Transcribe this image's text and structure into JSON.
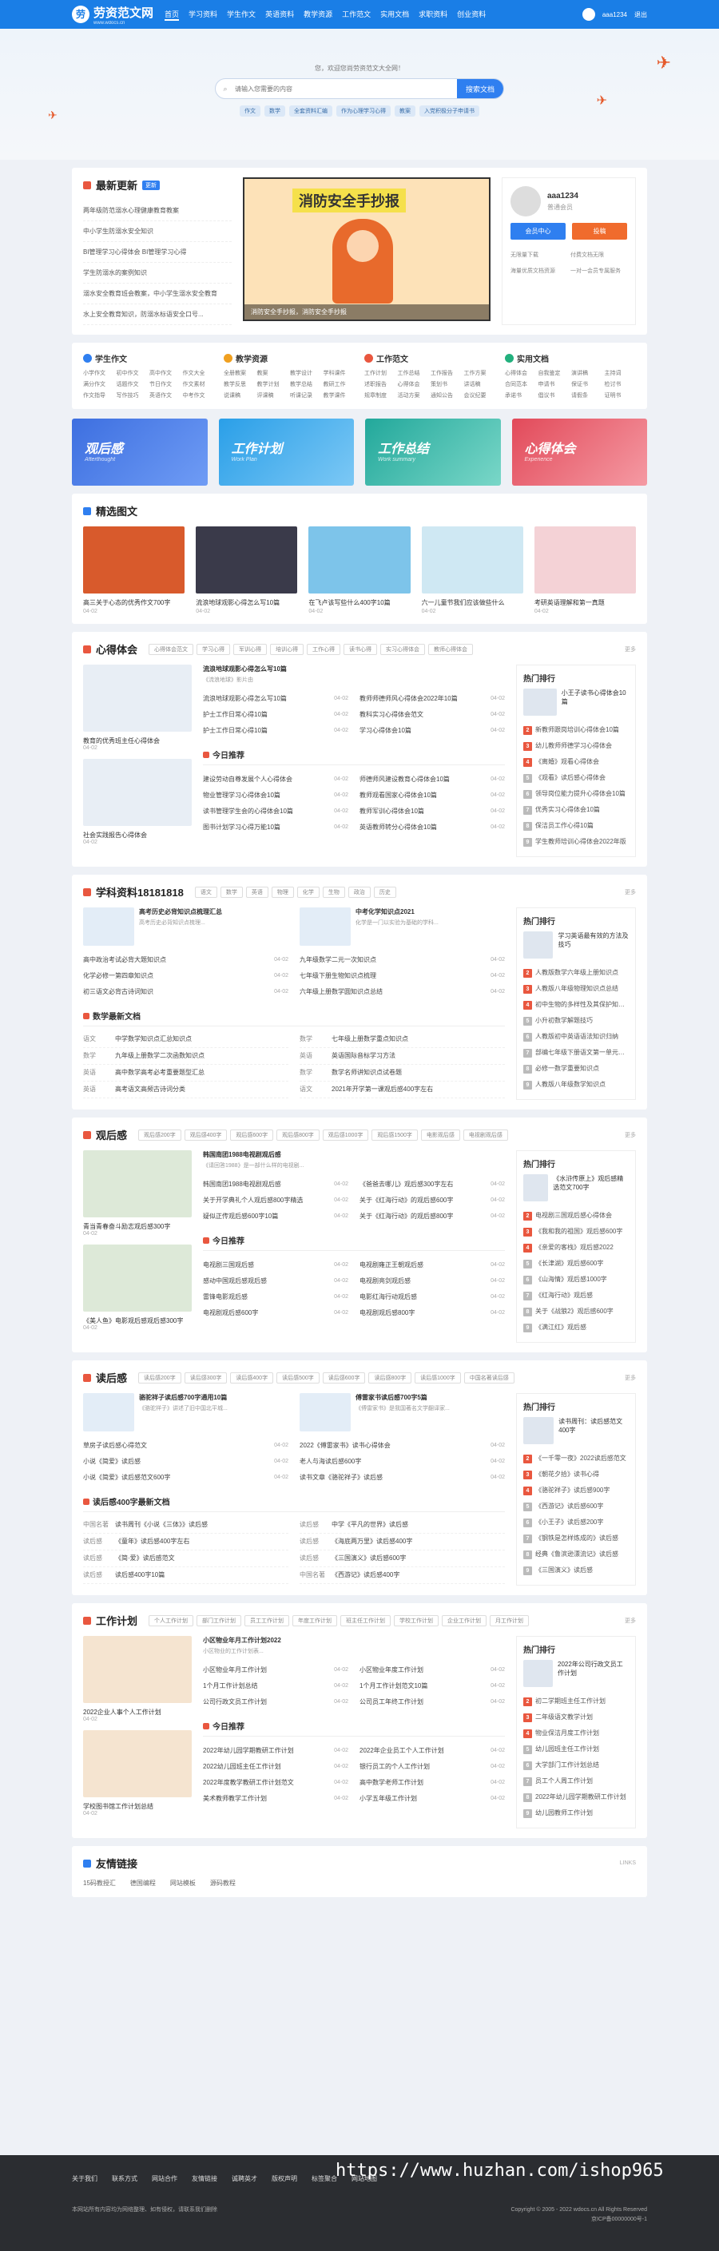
{
  "header": {
    "logo": "劳资范文网",
    "logo_sub": "www.wdocs.cn",
    "nav": [
      "首页",
      "学习资料",
      "学生作文",
      "英语资料",
      "教学资源",
      "工作范文",
      "实用文档",
      "求职资料",
      "创业资料"
    ],
    "user": "aaa1234",
    "logout": "退出"
  },
  "hero": {
    "welcome": "您，欢迎您尚劳资范文大全网！",
    "placeholder": "请输入您需要的内容",
    "search_btn": "搜索文档",
    "keywords": [
      "作文",
      "数学",
      "全套资料汇编",
      "作为心理学习心得",
      "教案",
      "入党积极分子申请书"
    ]
  },
  "news": {
    "title": "最新更新",
    "badge": "更新",
    "items": [
      "两年级防范溺水心理健康教育教案",
      "中小学生防溺水安全知识",
      "BI管理学习心得体会 BI管理学习心得",
      "学生防溺水的案例知识",
      "溺水安全教育班会教案，中小学生溺水安全教育",
      "水上安全教育知识，防溺水标语安全口号..."
    ]
  },
  "banner": {
    "title": "消防安全手抄报",
    "caption": "消防安全手抄报，消防安全手抄报"
  },
  "user_card": {
    "name": "aaa1234",
    "desc": "普通会员",
    "btn1": "会员中心",
    "btn2": "投稿",
    "perks": [
      "无限量下载",
      "付费文档无限",
      "海量优质文档资源",
      "一对一会员专属服务"
    ]
  },
  "cats": [
    {
      "name": "学生作文",
      "items": [
        "小学作文",
        "初中作文",
        "高中作文",
        "作文大全",
        "满分作文",
        "话题作文",
        "节日作文",
        "作文素材",
        "作文指导",
        "写作技巧",
        "英语作文",
        "中考作文"
      ]
    },
    {
      "name": "教学资源",
      "items": [
        "全册教案",
        "教案",
        "教学设计",
        "学科课件",
        "教学反思",
        "教学计划",
        "教学总结",
        "教研工作",
        "说课稿",
        "评课稿",
        "听课记录",
        "教学课件"
      ]
    },
    {
      "name": "工作范文",
      "items": [
        "工作计划",
        "工作总结",
        "工作报告",
        "工作方案",
        "述职报告",
        "心得体会",
        "策划书",
        "讲话稿",
        "规章制度",
        "活动方案",
        "通知公告",
        "会议纪要"
      ]
    },
    {
      "name": "实用文档",
      "items": [
        "心得体会",
        "自我鉴定",
        "演讲稿",
        "主持词",
        "合同范本",
        "申请书",
        "保证书",
        "检讨书",
        "承诺书",
        "倡议书",
        "请假条",
        "证明书"
      ]
    }
  ],
  "promo": [
    {
      "t": "观后感",
      "s": "Afterthought"
    },
    {
      "t": "工作计划",
      "s": "Work Plan"
    },
    {
      "t": "工作总结",
      "s": "Work summary"
    },
    {
      "t": "心得体会",
      "s": "Experience"
    }
  ],
  "pics": {
    "title": "精选图文",
    "items": [
      {
        "t": "高三关于心态的优秀作文700字",
        "d": "04-02"
      },
      {
        "t": "流浪地球观影心得怎么写10篇",
        "d": "04-02"
      },
      {
        "t": "在飞卢该写些什么400字10篇",
        "d": "04-02"
      },
      {
        "t": "六一儿童节我们应该做些什么",
        "d": "04-02"
      },
      {
        "t": "考研英语理解和第一真题",
        "d": "04-02"
      }
    ]
  },
  "s1": {
    "title": "心得体会",
    "tags": [
      "心得体会范文",
      "学习心得",
      "军训心得",
      "培训心得",
      "工作心得",
      "读书心得",
      "实习心得体会",
      "教师心得体会"
    ],
    "more": "更多",
    "left": [
      {
        "c": "教育的优秀班主任心得体会",
        "d": "04-02"
      },
      {
        "c": "社会实践报告心得体会",
        "d": "04-02"
      }
    ],
    "feat": {
      "t": "流浪地球观影心得怎么写10篇",
      "p": "《流浪地球》影片由"
    },
    "list": [
      [
        "流浪地球观影心得怎么写10篇",
        "04-02"
      ],
      [
        "教师师德师风心得体会2022年10篇",
        "04-02"
      ],
      [
        "护士工作日常心得10篇",
        "04-02"
      ],
      [
        "教科实习心得体会范文",
        "04-02"
      ],
      [
        "护士工作日常心得10篇",
        "04-02"
      ],
      [
        "学习心得体会10篇",
        "04-02"
      ]
    ],
    "sub": "今日推荐",
    "sublist": [
      [
        "建设劳动自尊发展个人心得体会",
        "04-02"
      ],
      [
        "师德师风建设教育心得体会10篇",
        "04-02"
      ],
      [
        "物业管理学习心得体会10篇",
        "04-02"
      ],
      [
        "教师观看国家心得体会10篇",
        "04-02"
      ],
      [
        "读书管理学生会的心得体会10篇",
        "04-02"
      ],
      [
        "教师军训心得体会10篇",
        "04-02"
      ],
      [
        "图书计划学习心得万能10篇",
        "04-02"
      ],
      [
        "英语教师转分心得体会10篇",
        "04-02"
      ]
    ],
    "hot": {
      "title": "热门排行",
      "top": "小王子读书心得体会10篇",
      "items": [
        "新教师跟岗培训心得体会10篇",
        "幼儿教师师德学习心得体会",
        "《离婚》观看心得体会",
        "《观看》读后感心得体会",
        "领导岗位能力提升心得体会10篇",
        "优秀实习心得体会10篇",
        "保洁员工作心得10篇",
        "学生教师培训心得体会2022年版"
      ]
    }
  },
  "s2": {
    "title": "学科资料18181818",
    "tags": [
      "语文",
      "数学",
      "英语",
      "物理",
      "化学",
      "生物",
      "政治",
      "历史"
    ],
    "more": "更多",
    "feat1": {
      "t": "高考历史必背知识点梳理汇总",
      "p": "高考历史必背知识点梳理..."
    },
    "feat2": {
      "t": "中考化学知识点2021",
      "p": "化学是一门以实验为基础的学科..."
    },
    "list": [
      [
        "高中政治考试必背大题知识点",
        "04-02"
      ],
      [
        "九年级数学二元一次知识点",
        "04-02"
      ],
      [
        "化学必修一第四章知识点",
        "04-02"
      ],
      [
        "七年级下册生物知识点梳理",
        "04-02"
      ],
      [
        "初三语文必背古诗词知识",
        "04-02"
      ],
      [
        "六年级上册数学圆知识点总结",
        "04-02"
      ]
    ],
    "sub": "数学最新文档",
    "docs": [
      [
        "语文",
        "中学数学知识点汇总知识点"
      ],
      [
        "数学",
        "七年级上册数学重点知识点"
      ],
      [
        "数学",
        "九年级上册数学二次函数知识点"
      ],
      [
        "英语",
        "英语国际音标学习方法"
      ],
      [
        "英语",
        "高中数学高考必考重要题型汇总"
      ],
      [
        "数学",
        "数学名师讲知识点试卷题"
      ],
      [
        "英语",
        "高考语文高频古诗词分类"
      ],
      [
        "语文",
        "2021年开学第一课观后感400字左右"
      ]
    ],
    "hot": {
      "title": "热门排行",
      "top": "学习英语最有效的方法及技巧",
      "items": [
        "人教版数学六年级上册知识点",
        "人教版八年级物理知识点总结",
        "初中生物的多样性及其保护知识点",
        "小升初数学解题技巧",
        "人教版初中英语语法知识归纳",
        "部编七年级下册语文第一单元知识点",
        "必修一数学重要知识点",
        "人教版八年级数学知识点"
      ]
    }
  },
  "s3": {
    "title": "观后感",
    "tags": [
      "观后感200字",
      "观后感400字",
      "观后感600字",
      "观后感800字",
      "观后感1000字",
      "观后感1500字",
      "电影观后感",
      "电视剧观后感"
    ],
    "more": "更多",
    "left": [
      {
        "c": "青当青春奋斗励志观后感300字",
        "d": "04-02"
      },
      {
        "c": "《美人鱼》电影观后感观后感300字",
        "d": "04-02"
      }
    ],
    "feat": {
      "t": "韩国南团1988电视剧观后感",
      "p": "《请回答1988》是一部什么样的电视剧..."
    },
    "list": [
      [
        "韩国南团1988电视剧观后感",
        "04-02"
      ],
      [
        "《爸爸去哪儿》观后感300字左右",
        "04-02"
      ],
      [
        "关于开学典礼个人观后感800字精选",
        "04-02"
      ],
      [
        "关于《红海行动》的观后感600字",
        "04-02"
      ],
      [
        "疑似正传观后感600字10篇",
        "04-02"
      ],
      [
        "关于《红海行动》的观后感800字",
        "04-02"
      ]
    ],
    "sub": "今日推荐",
    "sublist": [
      [
        "电视剧三国观后感",
        "04-02"
      ],
      [
        "电视剧雍正王朝观后感",
        "04-02"
      ],
      [
        "感动中国观后感观后感",
        "04-02"
      ],
      [
        "电视剧亮剑观后感",
        "04-02"
      ],
      [
        "雷锋电影观后感",
        "04-02"
      ],
      [
        "电影红海行动观后感",
        "04-02"
      ],
      [
        "电视剧观后感600字",
        "04-02"
      ],
      [
        "电视剧观后感800字",
        "04-02"
      ]
    ],
    "hot": {
      "title": "热门排行",
      "top": "《水浒传原上》观后感精选范文700字",
      "items": [
        "电视剧三国观后感心得体会",
        "《我和我的祖国》观后感600字",
        "《亲爱的客栈》观后感2022",
        "《长津湖》观后感600字",
        "《山海情》观后感1000字",
        "《红海行动》观后感",
        "关于《战狼2》观后感600字",
        "《满江红》观后感"
      ]
    }
  },
  "s4": {
    "title": "读后感",
    "tags": [
      "读后感200字",
      "读后感300字",
      "读后感400字",
      "读后感500字",
      "读后感600字",
      "读后感800字",
      "读后感1000字",
      "中国名著读后感"
    ],
    "more": "更多",
    "feat1": {
      "t": "骆驼祥子读后感700字通用10篇",
      "p": "《骆驼祥子》讲述了旧中国北平城..."
    },
    "feat2": {
      "t": "傅雷家书读后感700字5篇",
      "p": "《傅雷家书》是我国著名文学翻译家..."
    },
    "list": [
      [
        "草房子读后感心得范文",
        "04-02"
      ],
      [
        "2022《傅雷家书》读书心得体会",
        "04-02"
      ],
      [
        "小说《简爱》读后感",
        "04-02"
      ],
      [
        "老人与海读后感600字",
        "04-02"
      ],
      [
        "小说《简爱》读后感范文600字",
        "04-02"
      ],
      [
        "读书文章《骆驼祥子》读后感",
        "04-02"
      ]
    ],
    "sub": "读后感400字最新文档",
    "docs": [
      [
        "中国名著",
        "读书周刊《小说《三体》》读后感"
      ],
      [
        "读后感",
        "中学《平凡的世界》读后感"
      ],
      [
        "读后感",
        "《童年》读后感400字左右"
      ],
      [
        "读后感",
        "《海底两万里》读后感400字"
      ],
      [
        "读后感",
        "《简·爱》读后感范文"
      ],
      [
        "读后感",
        "《三国演义》读后感600字"
      ],
      [
        "读后感",
        "读后感400字10篇"
      ],
      [
        "中国名著",
        "《西游记》读后感400字"
      ]
    ],
    "hot": {
      "title": "热门排行",
      "top": "读书周刊：读后感范文400字",
      "items": [
        "《一千零一夜》2022读后感范文",
        "《朝花夕拾》读书心得",
        "《骆驼祥子》读后感900字",
        "《西游记》读后感600字",
        "《小王子》读后感200字",
        "《钢铁是怎样炼成的》读后感",
        "经典《鲁滨逊漂流记》读后感",
        "《三国演义》读后感"
      ]
    }
  },
  "s5": {
    "title": "工作计划",
    "tags": [
      "个人工作计划",
      "部门工作计划",
      "员工工作计划",
      "年度工作计划",
      "班主任工作计划",
      "学校工作计划",
      "企业工作计划",
      "月工作计划"
    ],
    "more": "更多",
    "left": [
      {
        "c": "2022企业人事个人工作计划",
        "d": "04-02"
      },
      {
        "c": "学校图书馆工作计划总结",
        "d": "04-02"
      }
    ],
    "feat": {
      "t": "小区物业年月工作计划2022",
      "p": "小区物业的工作计划表..."
    },
    "list": [
      [
        "小区物业年月工作计划",
        "04-02"
      ],
      [
        "小区物业年度工作计划",
        "04-02"
      ],
      [
        "1个月工作计划总结",
        "04-02"
      ],
      [
        "1个月工作计划范文10篇",
        "04-02"
      ],
      [
        "公司行政文员工作计划",
        "04-02"
      ],
      [
        "公司员工年终工作计划",
        "04-02"
      ]
    ],
    "sub": "今日推荐",
    "sublist": [
      [
        "2022年幼儿园学期教研工作计划",
        "04-02"
      ],
      [
        "2022年企业员工个人工作计划",
        "04-02"
      ],
      [
        "2022幼儿园班主任工作计划",
        "04-02"
      ],
      [
        "银行员工的个人工作计划",
        "04-02"
      ],
      [
        "2022年度教学教研工作计划范文",
        "04-02"
      ],
      [
        "高中数学老师工作计划",
        "04-02"
      ],
      [
        "美术教师教学工作计划",
        "04-02"
      ],
      [
        "小学五年级工作计划",
        "04-02"
      ]
    ],
    "hot": {
      "title": "热门排行",
      "top": "2022年公司行政文员工作计划",
      "items": [
        "初二学期班主任工作计划",
        "二年级语文教学计划",
        "物业保洁月度工作计划",
        "幼儿园班主任工作计划",
        "大学部门工作计划总结",
        "员工个人周工作计划",
        "2022年幼儿园学期教研工作计划",
        "幼儿园教师工作计划"
      ]
    }
  },
  "friends": {
    "title": "友情链接",
    "more": "LINKS",
    "items": [
      "15码教授汇",
      "德国编程",
      "网站模板",
      "源码教程"
    ]
  },
  "footer": {
    "links": [
      "关于我们",
      "联系方式",
      "网站合作",
      "友情链接",
      "诚聘英才",
      "版权声明",
      "标签聚合",
      "网站地图"
    ],
    "left": "本网站所有内容均为网络整理、如有侵权，请联系我们删除",
    "copy": "Copyright © 2005 - 2022 wdocs.cn All Rights Reserved",
    "beian": "京ICP备00000000号-1"
  },
  "watermark": "https://www.huzhan.com/ishop965",
  "colors": {
    "primary": "#1a7ee6",
    "accent": "#e9573f"
  }
}
